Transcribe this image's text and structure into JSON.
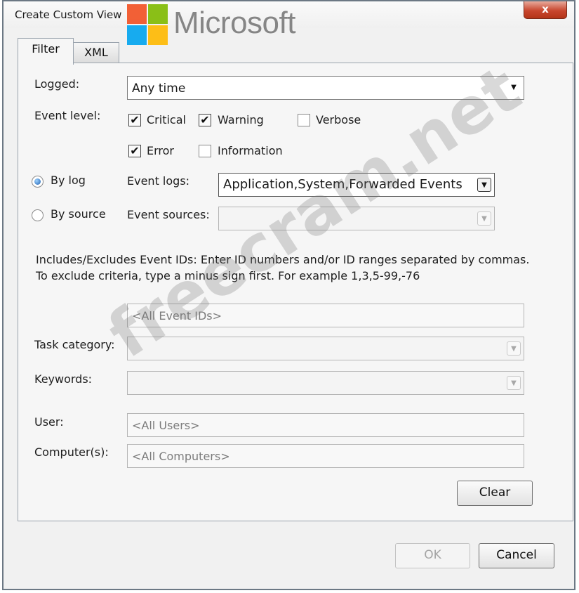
{
  "window": {
    "title": "Create Custom View",
    "close_symbol": "x"
  },
  "logo": {
    "text": "Microsoft",
    "colors": [
      "#f25022",
      "#7fba00",
      "#00a4ef",
      "#ffb900"
    ]
  },
  "tabs": [
    {
      "label": "Filter",
      "active": true
    },
    {
      "label": "XML",
      "active": false
    }
  ],
  "filter": {
    "logged_label": "Logged:",
    "logged_value": "Any time",
    "event_level_label": "Event level:",
    "levels": [
      {
        "label": "Critical",
        "checked": true
      },
      {
        "label": "Warning",
        "checked": true
      },
      {
        "label": "Verbose",
        "checked": false
      },
      {
        "label": "Error",
        "checked": true
      },
      {
        "label": "Information",
        "checked": false
      }
    ],
    "by_log_label": "By log",
    "by_source_label": "By source",
    "event_logs_label": "Event logs:",
    "event_logs_value": "Application,System,Forwarded Events",
    "event_sources_label": "Event sources:",
    "event_sources_value": "",
    "event_ids_description": "Includes/Excludes Event IDs: Enter ID numbers and/or ID ranges separated by commas. To exclude criteria, type a minus sign first. For example 1,3,5-99,-76",
    "event_ids_placeholder": "<All Event IDs>",
    "task_category_label": "Task category:",
    "keywords_label": "Keywords:",
    "user_label": "User:",
    "user_placeholder": "<All Users>",
    "computers_label": "Computer(s):",
    "computers_placeholder": "<All Computers>",
    "clear_label": "Clear"
  },
  "footer": {
    "ok_label": "OK",
    "cancel_label": "Cancel"
  },
  "watermark": "freecram.net"
}
